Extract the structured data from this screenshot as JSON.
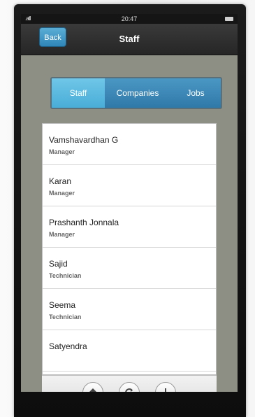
{
  "status_bar": {
    "signal": ".atll",
    "time": "20:47"
  },
  "nav_bar": {
    "back_label": "Back",
    "title": "Staff"
  },
  "segmented_control": {
    "selected": "Staff",
    "tabs": [
      {
        "label": "Staff"
      },
      {
        "label": "Companies"
      },
      {
        "label": "Jobs"
      }
    ]
  },
  "staff_list": [
    {
      "name": "Vamshavardhan G",
      "role": "Manager"
    },
    {
      "name": "Karan",
      "role": "Manager"
    },
    {
      "name": "Prashanth Jonnala",
      "role": "Manager"
    },
    {
      "name": "Sajid",
      "role": "Technician"
    },
    {
      "name": "Seema",
      "role": "Technician"
    },
    {
      "name": "Satyendra",
      "role": ""
    }
  ],
  "toolbar": {
    "buttons": [
      {
        "icon": "home-icon"
      },
      {
        "icon": "refresh-icon"
      },
      {
        "icon": "add-icon"
      }
    ]
  },
  "colors": {
    "accent": "#49add7",
    "segment_bg": "#2f79a8",
    "screen_bg": "#8d8f84"
  }
}
